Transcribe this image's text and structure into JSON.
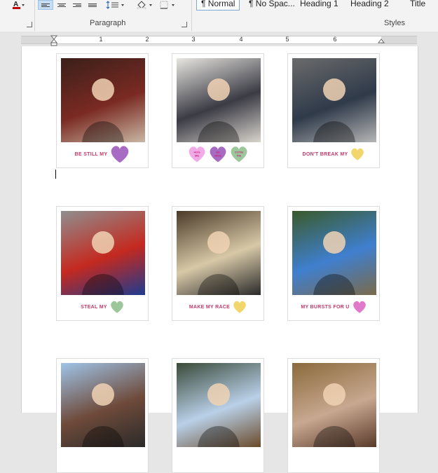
{
  "ribbon": {
    "paragraph_label": "Paragraph",
    "styles_label": "Styles",
    "styles": [
      "¶ Normal",
      "¶ No Spac...",
      "Heading 1",
      "Heading 2",
      "Title"
    ],
    "font_color": "#c00000"
  },
  "ruler": {
    "numbers": [
      "1",
      "2",
      "3",
      "4",
      "5",
      "6"
    ]
  },
  "cards": [
    {
      "caption": "BE STILL MY",
      "heart_color": "#a86bc4",
      "bg": [
        "#3b1f1a",
        "#7a2a22",
        "#c9b7a4"
      ]
    },
    {
      "caption": "",
      "hearts": [
        {
          "text": "HUG ME",
          "color": "#f2a9e8"
        },
        {
          "text": "BE MINE",
          "color": "#a86bc4"
        },
        {
          "text": "CUTIE PIE",
          "color": "#9cc79a"
        }
      ],
      "bg": [
        "#e8e6e0",
        "#3b3b45",
        "#d8d4cc"
      ]
    },
    {
      "caption": "DON'T BREAK MY",
      "heart_color": "#f0d66b",
      "bg": [
        "#6b6b6b",
        "#2f3a4a",
        "#b5b5b5"
      ]
    },
    {
      "caption": "STEAL MY",
      "heart_color": "#9cc79a",
      "bg": [
        "#8f8f8f",
        "#c4291f",
        "#1e3b8f"
      ]
    },
    {
      "caption": "MAKE MY RACE",
      "heart_color": "#f0d66b",
      "bg": [
        "#4a3a28",
        "#d7c8a7",
        "#2a2a2a"
      ]
    },
    {
      "caption": "MY BURSTS FOR U",
      "heart_color": "#e07ac8",
      "bg": [
        "#3a5a2a",
        "#3f7fcf",
        "#7a6a4a"
      ]
    },
    {
      "caption": "",
      "bg": [
        "#9fc4e8",
        "#6e4a3a",
        "#2a2a2a"
      ]
    },
    {
      "caption": "",
      "bg": [
        "#3a4a3a",
        "#b9d0e8",
        "#6a4a2a"
      ]
    },
    {
      "caption": "",
      "bg": [
        "#8a6a3a",
        "#c8a890",
        "#5a3a2a"
      ]
    }
  ]
}
